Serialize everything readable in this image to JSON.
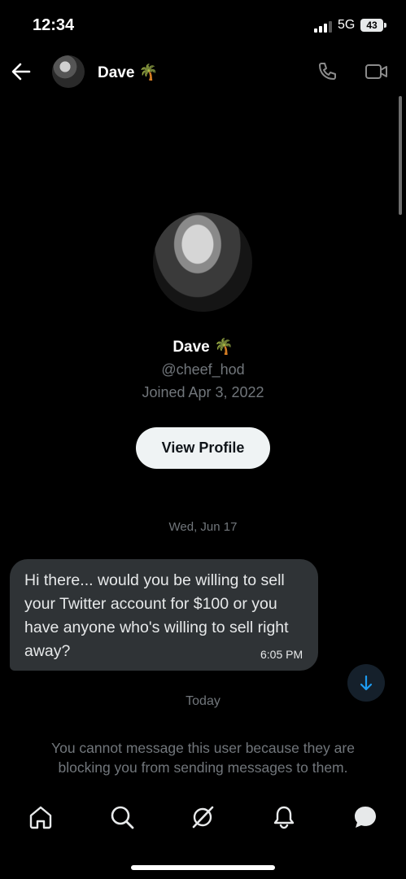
{
  "status_bar": {
    "time": "12:34",
    "network": "5G",
    "battery": "43"
  },
  "header": {
    "name": "Dave 🌴"
  },
  "profile": {
    "name": "Dave 🌴",
    "handle": "@cheef_hod",
    "joined": "Joined Apr 3, 2022",
    "view_profile_label": "View Profile"
  },
  "conversation": {
    "date_1": "Wed, Jun 17",
    "message": {
      "text": "Hi there... would you be willing to sell your Twitter account for $100  or you have anyone who's willing to sell right away?",
      "time": "6:05 PM"
    },
    "date_2": "Today",
    "blocked_notice": "You cannot message this user because they are blocking you from sending messages to them."
  },
  "nav": {
    "items": [
      "home-icon",
      "search-icon",
      "grok-icon",
      "notifications-icon",
      "messages-icon"
    ]
  },
  "colors": {
    "background": "#000000",
    "bubble": "#2f3336",
    "muted": "#71767b",
    "accent": "#1d9bf0"
  }
}
